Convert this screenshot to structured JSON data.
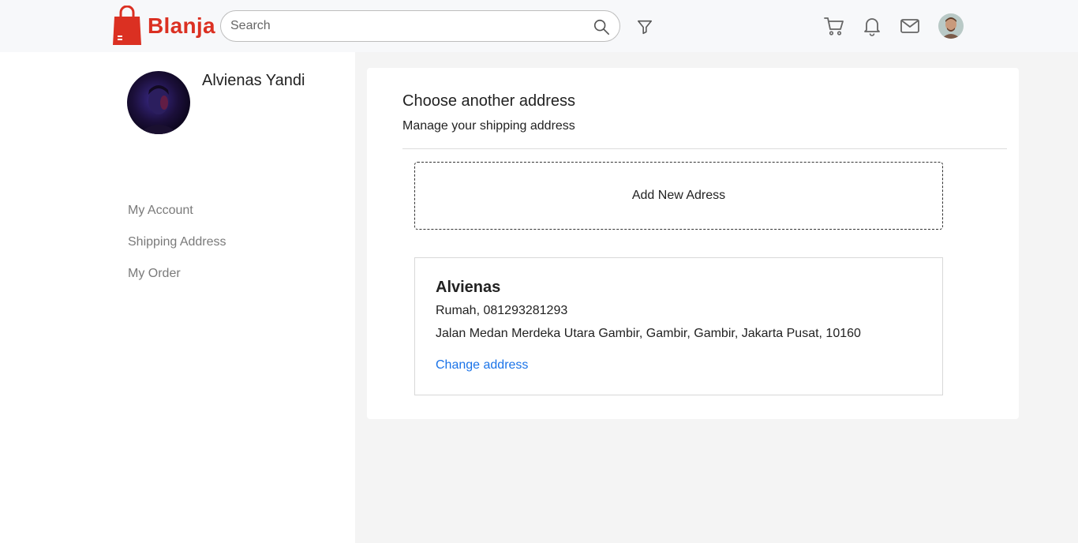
{
  "brand": {
    "name": "Blanja",
    "color": "#db3022"
  },
  "search": {
    "placeholder": "Search",
    "value": ""
  },
  "header": {
    "icons": [
      "search-icon",
      "filter-icon",
      "cart-icon",
      "bell-icon",
      "mail-icon"
    ]
  },
  "profile": {
    "name": "Alvienas Yandi"
  },
  "sidebar": {
    "items": [
      {
        "label": "My Account"
      },
      {
        "label": "Shipping Address"
      },
      {
        "label": "My Order"
      }
    ]
  },
  "main": {
    "title": "Choose another address",
    "subtitle": "Manage your shipping address",
    "add_button": "Add New Adress",
    "address": {
      "name": "Alvienas",
      "phone_line": "Rumah, 081293281293",
      "street": "Jalan Medan Merdeka Utara Gambir, Gambir, Gambir, Jakarta Pusat, 10160",
      "change_label": "Change address"
    }
  },
  "colors": {
    "link": "#1a73e8",
    "sidebar_text": "#7a7a7a"
  }
}
